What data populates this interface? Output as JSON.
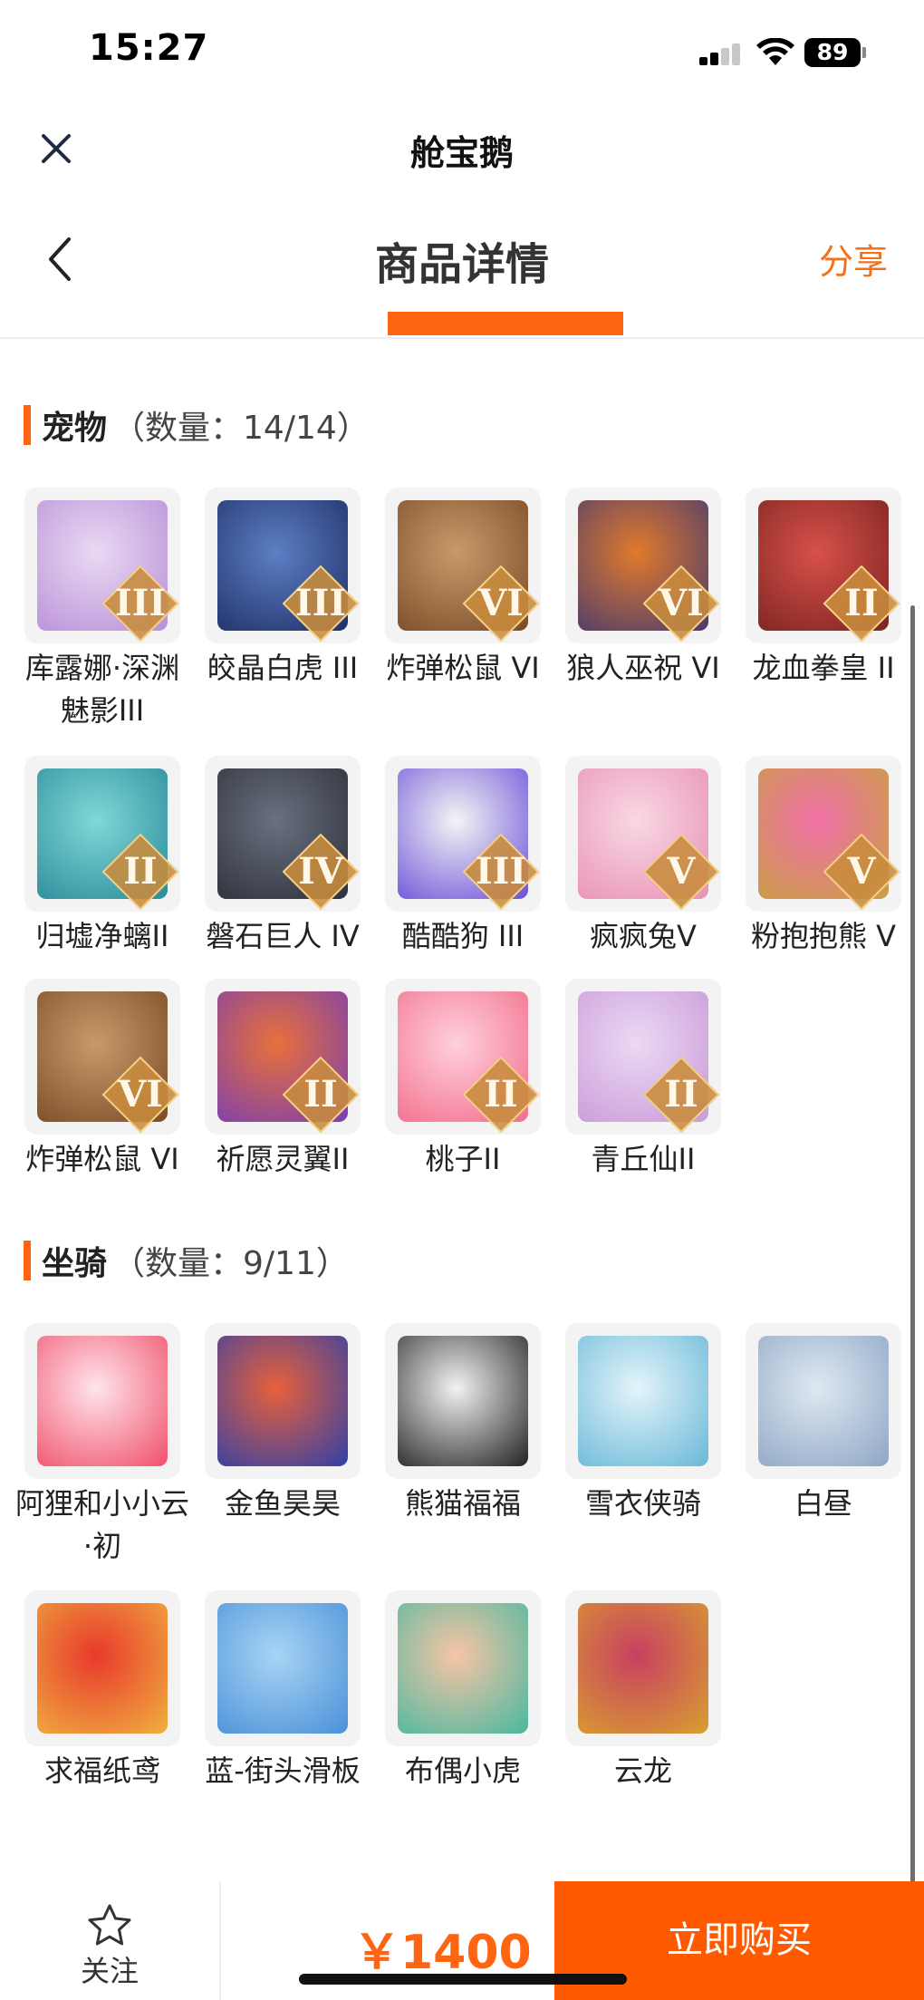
{
  "status_bar": {
    "time": "15:27",
    "battery": "89"
  },
  "mini_program": {
    "title": "舱宝鹅"
  },
  "page": {
    "title": "商品详情",
    "share_label": "分享"
  },
  "sections": [
    {
      "name": "宠物",
      "count_text": "（数量：14/14）",
      "items": [
        {
          "label": "库露娜·深渊魅影III",
          "grade": "III",
          "art": [
            "#e9d9f2",
            "#b88fd8"
          ]
        },
        {
          "label": "皎晶白虎 III",
          "grade": "III",
          "art": [
            "#5d7fc4",
            "#1e2f66"
          ]
        },
        {
          "label": "炸弹松鼠 VI",
          "grade": "VI",
          "art": [
            "#c89a6a",
            "#7a4b26"
          ]
        },
        {
          "label": "狼人巫祝 VI",
          "grade": "VI",
          "art": [
            "#e07a2c",
            "#4a3a6e"
          ]
        },
        {
          "label": "龙血拳皇 II",
          "grade": "II",
          "art": [
            "#d8504a",
            "#7a2420"
          ]
        },
        {
          "label": "归墟净螭II",
          "grade": "II",
          "art": [
            "#7fd8d8",
            "#2a8a98"
          ]
        },
        {
          "label": "磐石巨人 IV",
          "grade": "IV",
          "art": [
            "#6a7080",
            "#2c3038"
          ]
        },
        {
          "label": "酷酷狗 III",
          "grade": "III",
          "art": [
            "#f4f4f4",
            "#6b4fd8"
          ]
        },
        {
          "label": "疯疯兔V",
          "grade": "V",
          "art": [
            "#f8d8e4",
            "#e890b4"
          ]
        },
        {
          "label": "粉抱抱熊 V",
          "grade": "V",
          "art": [
            "#f070a8",
            "#c8a040"
          ]
        },
        {
          "label": "炸弹松鼠 VI",
          "grade": "VI",
          "art": [
            "#c89a6a",
            "#7a4b26"
          ]
        },
        {
          "label": "祈愿灵翼II",
          "grade": "II",
          "art": [
            "#e8703a",
            "#7a3fb0"
          ]
        },
        {
          "label": "桃子II",
          "grade": "II",
          "art": [
            "#ffd0dc",
            "#f26c8a"
          ]
        },
        {
          "label": "青丘仙II",
          "grade": "II",
          "art": [
            "#ecd8f4",
            "#c89ad8"
          ]
        }
      ]
    },
    {
      "name": "坐骑",
      "count_text": "（数量：9/11）",
      "items": [
        {
          "label": "阿狸和小小云·初",
          "grade": "",
          "art": [
            "#ffe4ec",
            "#f0506a"
          ]
        },
        {
          "label": "金鱼昊昊",
          "grade": "",
          "art": [
            "#e8603a",
            "#3040a8"
          ]
        },
        {
          "label": "熊猫福福",
          "grade": "",
          "art": [
            "#f2f2f2",
            "#222222"
          ]
        },
        {
          "label": "雪衣侠骑",
          "grade": "",
          "art": [
            "#e4f4fa",
            "#68b8d8"
          ]
        },
        {
          "label": "白昼",
          "grade": "",
          "art": [
            "#dfe8f2",
            "#8ea6c4"
          ]
        },
        {
          "label": "求福纸鸢",
          "grade": "",
          "art": [
            "#e83a2c",
            "#f0b040"
          ]
        },
        {
          "label": "蓝-街头滑板",
          "grade": "",
          "art": [
            "#a8d4f4",
            "#4a90d8"
          ]
        },
        {
          "label": "布偶小虎",
          "grade": "",
          "art": [
            "#f8c4a4",
            "#48b8a0"
          ]
        },
        {
          "label": "云龙",
          "grade": "",
          "art": [
            "#c84060",
            "#d8a030"
          ]
        }
      ]
    }
  ],
  "bottom_bar": {
    "follow_label": "关注",
    "price": "￥1400",
    "buy_label": "立即购买"
  },
  "colors": {
    "accent": "#ff6410",
    "share": "#f2711c",
    "buy_button": "#ff5a00"
  }
}
